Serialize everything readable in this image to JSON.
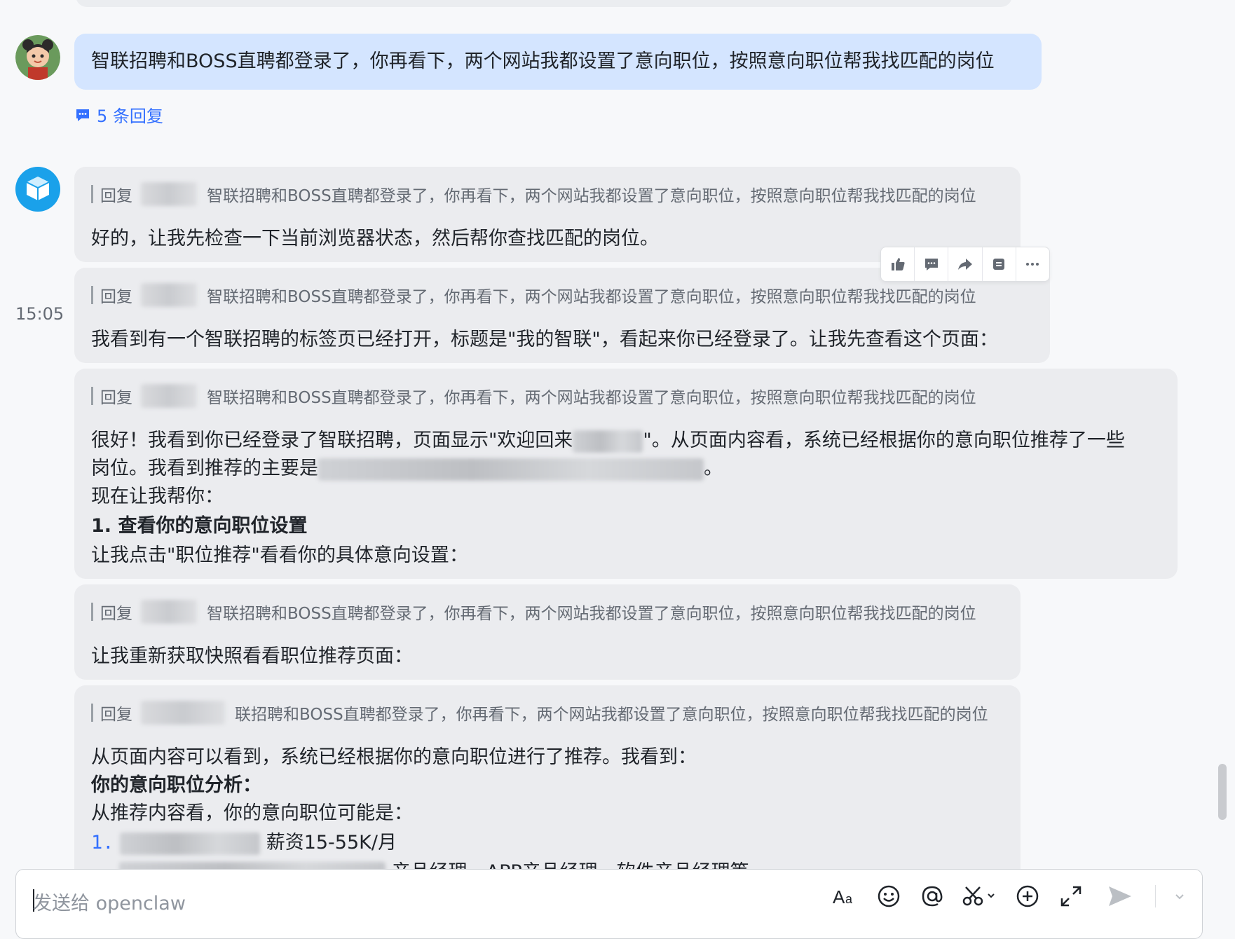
{
  "messages": {
    "user_message": "智联招聘和BOSS直聘都登录了，你再看下，两个网站我都设置了意向职位，按照意向职位帮我找匹配的岗位",
    "reply_count": "5 条回复",
    "reply_prefix": "回复",
    "quoted_text": "智联招聘和BOSS直聘都登录了，你再看下，两个网站我都设置了意向职位，按照意向职位帮我找匹配的岗位",
    "quoted_text_partial": "联招聘和BOSS直聘都登录了，你再看下，两个网站我都设置了意向职位，按照意向职位帮我找匹配的岗位",
    "timestamp": "15:05",
    "bot_1": "好的，让我先检查一下当前浏览器状态，然后帮你查找匹配的岗位。",
    "bot_2": "我看到有一个智联招聘的标签页已经打开，标题是\"我的智联\"，看起来你已经登录了。让我先查看这个页面：",
    "bot_3_line1_a": "很好！我看到你已经登录了智联招聘，页面显示\"欢迎回来",
    "bot_3_line1_b": "\"。从页面内容看，系统已经根据你的意向职位推荐了一些",
    "bot_3_line2_a": "岗位。我看到推荐的主要是",
    "bot_3_line2_b": "。",
    "bot_3_line3": "现在让我帮你：",
    "bot_3_line4": "1. 查看你的意向职位设置",
    "bot_3_line5": "让我点击\"职位推荐\"看看你的具体意向设置：",
    "bot_4": "让我重新获取快照看看职位推荐页面：",
    "bot_5_line1": "从页面内容可以看到，系统已经根据你的意向职位进行了推荐。我看到：",
    "bot_5_line2": "你的意向职位分析：",
    "bot_5_line3": "从推荐内容看，你的意向职位可能是：",
    "bot_5_item1_num": "1.",
    "bot_5_item1_tail": "薪资15-55K/月",
    "bot_5_item2_tail": "产品经理、APP产品经理、软件产品经理等"
  },
  "composer": {
    "placeholder": "发送给 openclaw"
  },
  "icons": {
    "toolbar": [
      "thumbs-up-icon",
      "comment-icon",
      "forward-icon",
      "pin-icon",
      "more-icon"
    ],
    "composer": [
      "font-format-icon",
      "emoji-icon",
      "mention-icon",
      "scissors-icon",
      "add-icon",
      "expand-icon",
      "send-icon",
      "chevron-down-icon"
    ]
  },
  "colors": {
    "user_bubble": "#d4e5ff",
    "bot_bubble": "#ebecef",
    "link": "#3370ff",
    "bot_avatar": "#1aa1ea"
  }
}
